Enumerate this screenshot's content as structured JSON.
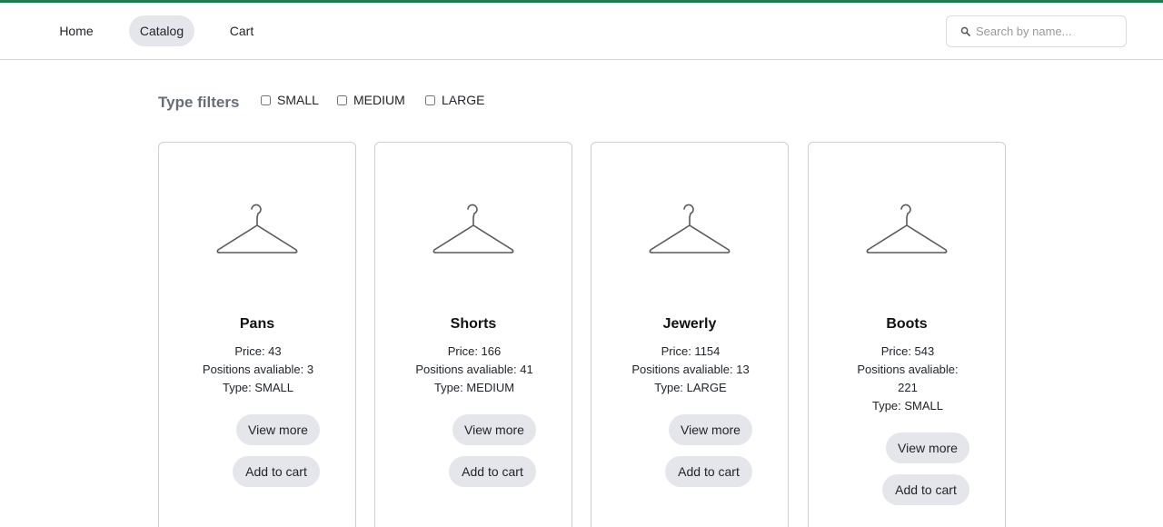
{
  "nav": {
    "home": "Home",
    "catalog": "Catalog",
    "cart": "Cart"
  },
  "search": {
    "placeholder": "Search by name..."
  },
  "filters": {
    "title": "Type filters",
    "options": [
      "SMALL",
      "MEDIUM",
      "LARGE"
    ]
  },
  "products": [
    {
      "name": "Pans",
      "price": "Price: 43",
      "positions": "Positions avaliable: 3",
      "type": "Type: SMALL",
      "view_label": "View more",
      "cart_label": "Add to cart"
    },
    {
      "name": "Shorts",
      "price": "Price: 166",
      "positions": "Positions avaliable: 41",
      "type": "Type: MEDIUM",
      "view_label": "View more",
      "cart_label": "Add to cart"
    },
    {
      "name": "Jewerly",
      "price": "Price: 1154",
      "positions": "Positions avaliable: 13",
      "type": "Type: LARGE",
      "view_label": "View more",
      "cart_label": "Add to cart"
    },
    {
      "name": "Boots",
      "price": "Price: 543",
      "positions": "Positions avaliable: 221",
      "type": "Type: SMALL",
      "view_label": "View more",
      "cart_label": "Add to cart"
    }
  ],
  "colors": {
    "accent_top_bar": "#1f7a4d",
    "pill_background": "#e4e6eb",
    "filters_title": "#666e78"
  }
}
